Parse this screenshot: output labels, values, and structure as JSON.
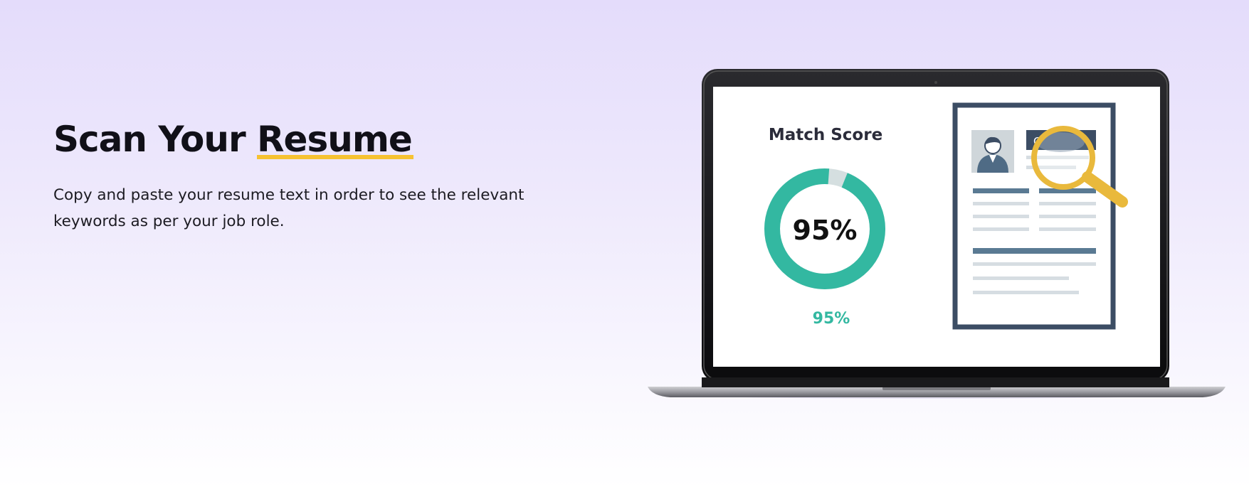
{
  "hero": {
    "headline_prefix": "Scan Your",
    "headline_highlight": "Resume",
    "description": "Copy and paste your resume text in order to see the relevant keywords as per your job role."
  },
  "illustration": {
    "score_title": "Match Score",
    "score_percent_center": "95%",
    "score_percent_caption": "95%",
    "match_score_fraction": 0.95,
    "cv_tab_label": "CV"
  },
  "colors": {
    "accent_teal": "#33b8a1",
    "ring_track": "#d5dfe0",
    "highlight_yellow": "#f6c232",
    "magnifier_yellow": "#e9b93c",
    "cv_frame_navy": "#3c4d64",
    "line_blue": "#5a7a93",
    "line_gray": "#d6dde2"
  },
  "icons": [
    "laptop-icon",
    "cv-document-icon",
    "avatar-icon",
    "magnifier-icon",
    "donut-gauge"
  ]
}
